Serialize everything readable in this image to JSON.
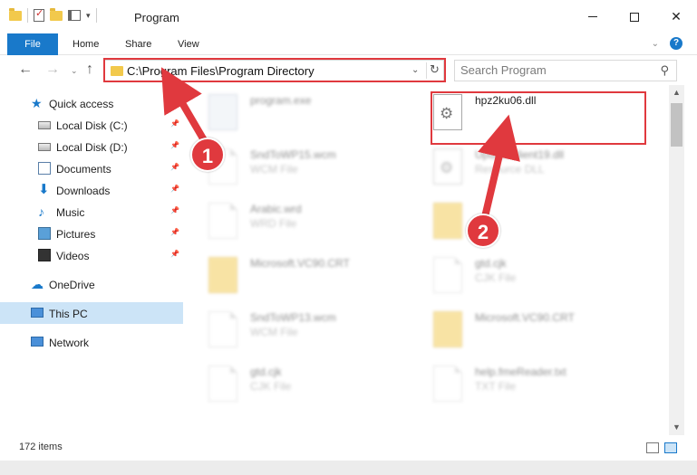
{
  "window": {
    "title": "Program",
    "controls": {
      "minimize": "—",
      "maximize": "☐",
      "close": "✕"
    }
  },
  "ribbon": {
    "tabs": {
      "file": "File",
      "home": "Home",
      "share": "Share",
      "view": "View"
    },
    "help": "?"
  },
  "nav": {
    "address_path": "C:\\Program Files\\Program Directory",
    "search_placeholder": "Search Program"
  },
  "sidebar": {
    "items": [
      {
        "label": "Quick access",
        "icon": "star-icon",
        "pinned": false
      },
      {
        "label": "Local Disk (C:)",
        "icon": "drive-icon",
        "pinned": true
      },
      {
        "label": "Local Disk (D:)",
        "icon": "drive-icon",
        "pinned": true
      },
      {
        "label": "Documents",
        "icon": "documents-icon",
        "pinned": true
      },
      {
        "label": "Downloads",
        "icon": "download-icon",
        "pinned": true
      },
      {
        "label": "Music",
        "icon": "music-icon",
        "pinned": true
      },
      {
        "label": "Pictures",
        "icon": "pictures-icon",
        "pinned": true
      },
      {
        "label": "Videos",
        "icon": "videos-icon",
        "pinned": true
      },
      {
        "label": "OneDrive",
        "icon": "cloud-icon",
        "pinned": false
      },
      {
        "label": "This PC",
        "icon": "computer-icon",
        "pinned": false,
        "selected": true
      },
      {
        "label": "Network",
        "icon": "network-icon",
        "pinned": false
      }
    ]
  },
  "files": {
    "col1": [
      {
        "name": "program.exe",
        "type": "",
        "icon": "exe-icon"
      },
      {
        "name": "SndToWP15.wcm",
        "type": "WCM File",
        "icon": "document-icon"
      },
      {
        "name": "Arabic.wrd",
        "type": "WRD File",
        "icon": "document-icon"
      },
      {
        "name": "Microsoft.VC90.CRT",
        "type": "",
        "icon": "folder-icon"
      },
      {
        "name": "SndToWP13.wcm",
        "type": "WCM File",
        "icon": "document-icon"
      },
      {
        "name": "gtd.cjk",
        "type": "CJK File",
        "icon": "document-icon"
      }
    ],
    "col2": [
      {
        "name": "hpz2ku06.dll",
        "type": "",
        "icon": "dll-gear-icon",
        "highlighted": true
      },
      {
        "name": "UpdateClient19.dll",
        "type": "Resource DLL",
        "icon": "dll-gear-icon"
      },
      {
        "name": "",
        "type": "",
        "icon": "folder-icon"
      },
      {
        "name": "gtd.cjk",
        "type": "CJK File",
        "icon": "document-icon"
      },
      {
        "name": "Microsoft.VC90.CRT",
        "type": "",
        "icon": "folder-icon"
      },
      {
        "name": "help.fmeReader.txt",
        "type": "TXT File",
        "icon": "document-icon"
      }
    ]
  },
  "status": {
    "item_count": "172 items"
  },
  "annotations": {
    "step1": "1",
    "step2": "2",
    "color": "#e0393e"
  },
  "colors": {
    "accent": "#1979ca",
    "selection": "#cce4f7",
    "annotation": "#e0393e"
  }
}
